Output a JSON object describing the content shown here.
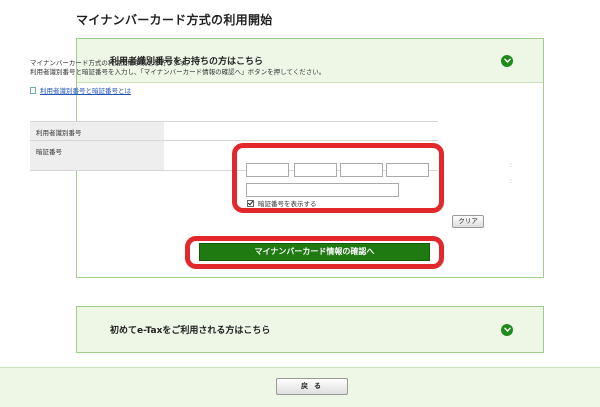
{
  "page": {
    "title": "マイナンバーカード方式の利用開始"
  },
  "panel1": {
    "title": "利用者識別番号をお持ちの方はこちら",
    "description_line1": "マイナンバーカード方式の利用開始手続きを行います。",
    "description_line2": "利用者識別番号と暗証番号を入力し、「マイナンバーカード情報の確認へ」ボタンを押してください。",
    "help_link": "利用者識別番号と暗証番号とは",
    "form": {
      "user_id_label": "利用者識別番号",
      "pin_label": "暗証番号",
      "show_pin_label": "暗証番号を表示する",
      "show_pin_checked": true
    },
    "clear_button": "クリア",
    "confirm_button": "マイナンバーカード情報の確認へ"
  },
  "panel2": {
    "title": "初めてe-Taxをご利用される方はこちら"
  },
  "footer": {
    "back_button": "戻 る"
  },
  "colors": {
    "accent_green": "#1f7a12",
    "panel_header_bg": "#eef7e6",
    "highlight_red": "#e3282b",
    "link_blue": "#2255bb"
  },
  "icons": {
    "panel_toggle": "chevron-down-icon",
    "help_link": "document-icon"
  }
}
